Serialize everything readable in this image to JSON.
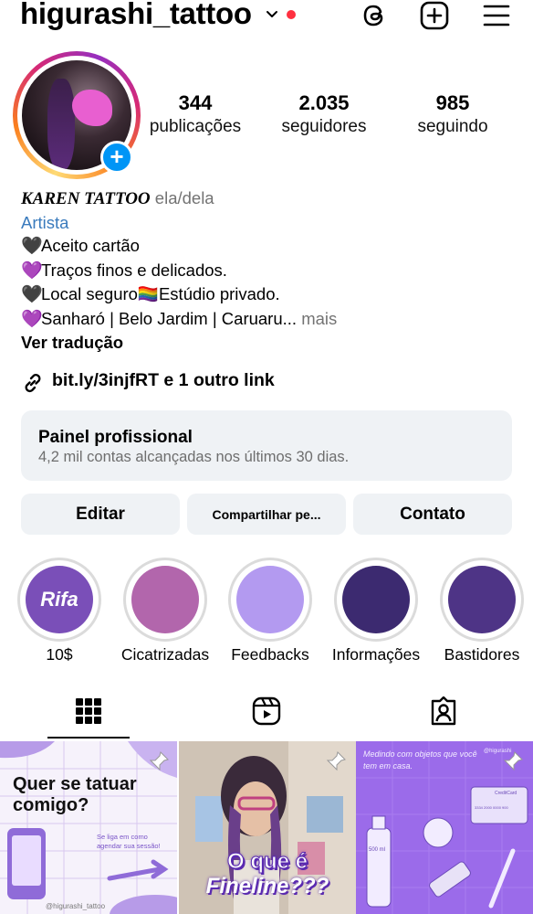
{
  "header": {
    "username": "higurashi_tattoo",
    "icons": [
      "chevron-down-icon",
      "threads-icon",
      "new-post-icon",
      "menu-icon"
    ],
    "notification_color": "#ff3040"
  },
  "profile": {
    "avatar_badge": "+",
    "stats": [
      {
        "value": "344",
        "label": "publicações"
      },
      {
        "value": "2.035",
        "label": "seguidores"
      },
      {
        "value": "985",
        "label": "seguindo"
      }
    ]
  },
  "bio": {
    "name": "KAREN TATTOO",
    "pronouns": "ela/dela",
    "category": "Artista",
    "lines": [
      {
        "emoji": "🖤",
        "text": "Aceito cartão"
      },
      {
        "emoji": "💜",
        "text": "Traços finos e delicados."
      },
      {
        "emoji": "🖤",
        "text": "Local seguro🏳️‍🌈Estúdio privado."
      },
      {
        "emoji": "💜",
        "text": "Sanharó | Belo Jardim | Caruaru..."
      }
    ],
    "more": "mais",
    "translate": "Ver tradução",
    "link": "bit.ly/3injfRT e 1 outro link"
  },
  "panel": {
    "title": "Painel profissional",
    "subtitle": "4,2 mil contas alcançadas nos últimos 30 dias."
  },
  "buttons": {
    "edit": "Editar",
    "share": "Compartilhar pe...",
    "contact": "Contato"
  },
  "highlights": [
    {
      "label": "10$",
      "cover_text": "Rifa",
      "color": "#7a4fb8"
    },
    {
      "label": "Cicatrizadas",
      "color": "#b266ac"
    },
    {
      "label": "Feedbacks",
      "color": "#b39af0"
    },
    {
      "label": "Informações",
      "color": "#3c2a70"
    },
    {
      "label": "Bastidores",
      "color": "#4e3486"
    }
  ],
  "tabs": [
    "grid-icon",
    "reels-icon",
    "tagged-icon"
  ],
  "posts": [
    {
      "title": "Quer se tatuar comigo?",
      "subtitle": "Se liga em como agendar sua sessão!",
      "handle": "@higurashi_tattoo",
      "pinned": true
    },
    {
      "title_top": "O que é",
      "title_bottom": "Fineline???",
      "pinned": true
    },
    {
      "title": "Medindo com objetos que você tem em casa.",
      "handle": "@higurashi",
      "bottle_label": "500 ml",
      "card_label": "CreditCard",
      "card_number": "3334 2000 0000 900",
      "pinned": true
    }
  ],
  "colors": {
    "link_blue": "#3a7bbd",
    "badge_blue": "#0095f6",
    "button_bg": "#eff2f5",
    "post_purple": "#9b6bea"
  }
}
